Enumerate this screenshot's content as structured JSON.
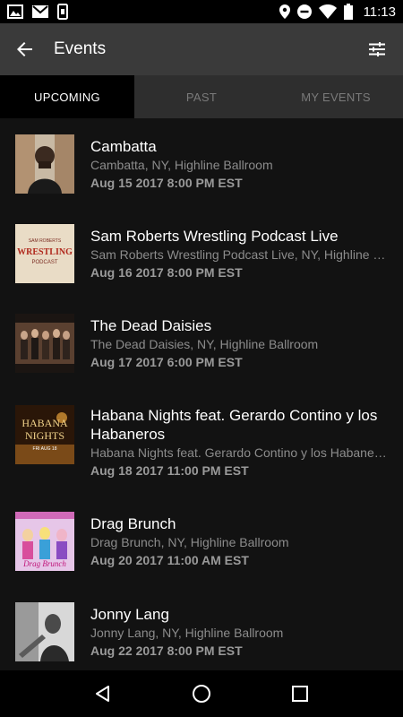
{
  "status": {
    "time": "11:13"
  },
  "header": {
    "title": "Events"
  },
  "tabs": [
    {
      "label": "UPCOMING"
    },
    {
      "label": "PAST"
    },
    {
      "label": "MY EVENTS"
    }
  ],
  "events": [
    {
      "title": "Cambatta",
      "venue": "Cambatta, NY, Highline Ballroom",
      "date": "Aug 15 2017 8:00 PM EST"
    },
    {
      "title": "Sam Roberts Wrestling Podcast Live",
      "venue": "Sam Roberts Wrestling Podcast Live, NY, Highline B...",
      "date": "Aug 16 2017 8:00 PM EST",
      "thumb_text": "WRESTLING",
      "thumb_sub": "PODCAST",
      "thumb_top": "SAM ROBERTS"
    },
    {
      "title": "The Dead Daisies",
      "venue": "The Dead Daisies, NY, Highline Ballroom",
      "date": "Aug 17 2017 6:00 PM EST"
    },
    {
      "title": "Habana Nights feat. Gerardo Contino y los Habaneros",
      "venue": "Habana Nights feat. Gerardo Contino y los Habaner...",
      "date": "Aug 18 2017 11:00 PM EST",
      "thumb_text": "HABANA",
      "thumb_sub": "NIGHTS",
      "thumb_top": "FRI AUG 18"
    },
    {
      "title": "Drag Brunch",
      "venue": "Drag Brunch, NY, Highline Ballroom",
      "date": "Aug 20 2017 11:00 AM EST",
      "thumb_text": "Drag Brunch"
    },
    {
      "title": "Jonny Lang",
      "venue": "Jonny Lang, NY, Highline Ballroom",
      "date": "Aug 22 2017 8:00 PM EST"
    }
  ]
}
